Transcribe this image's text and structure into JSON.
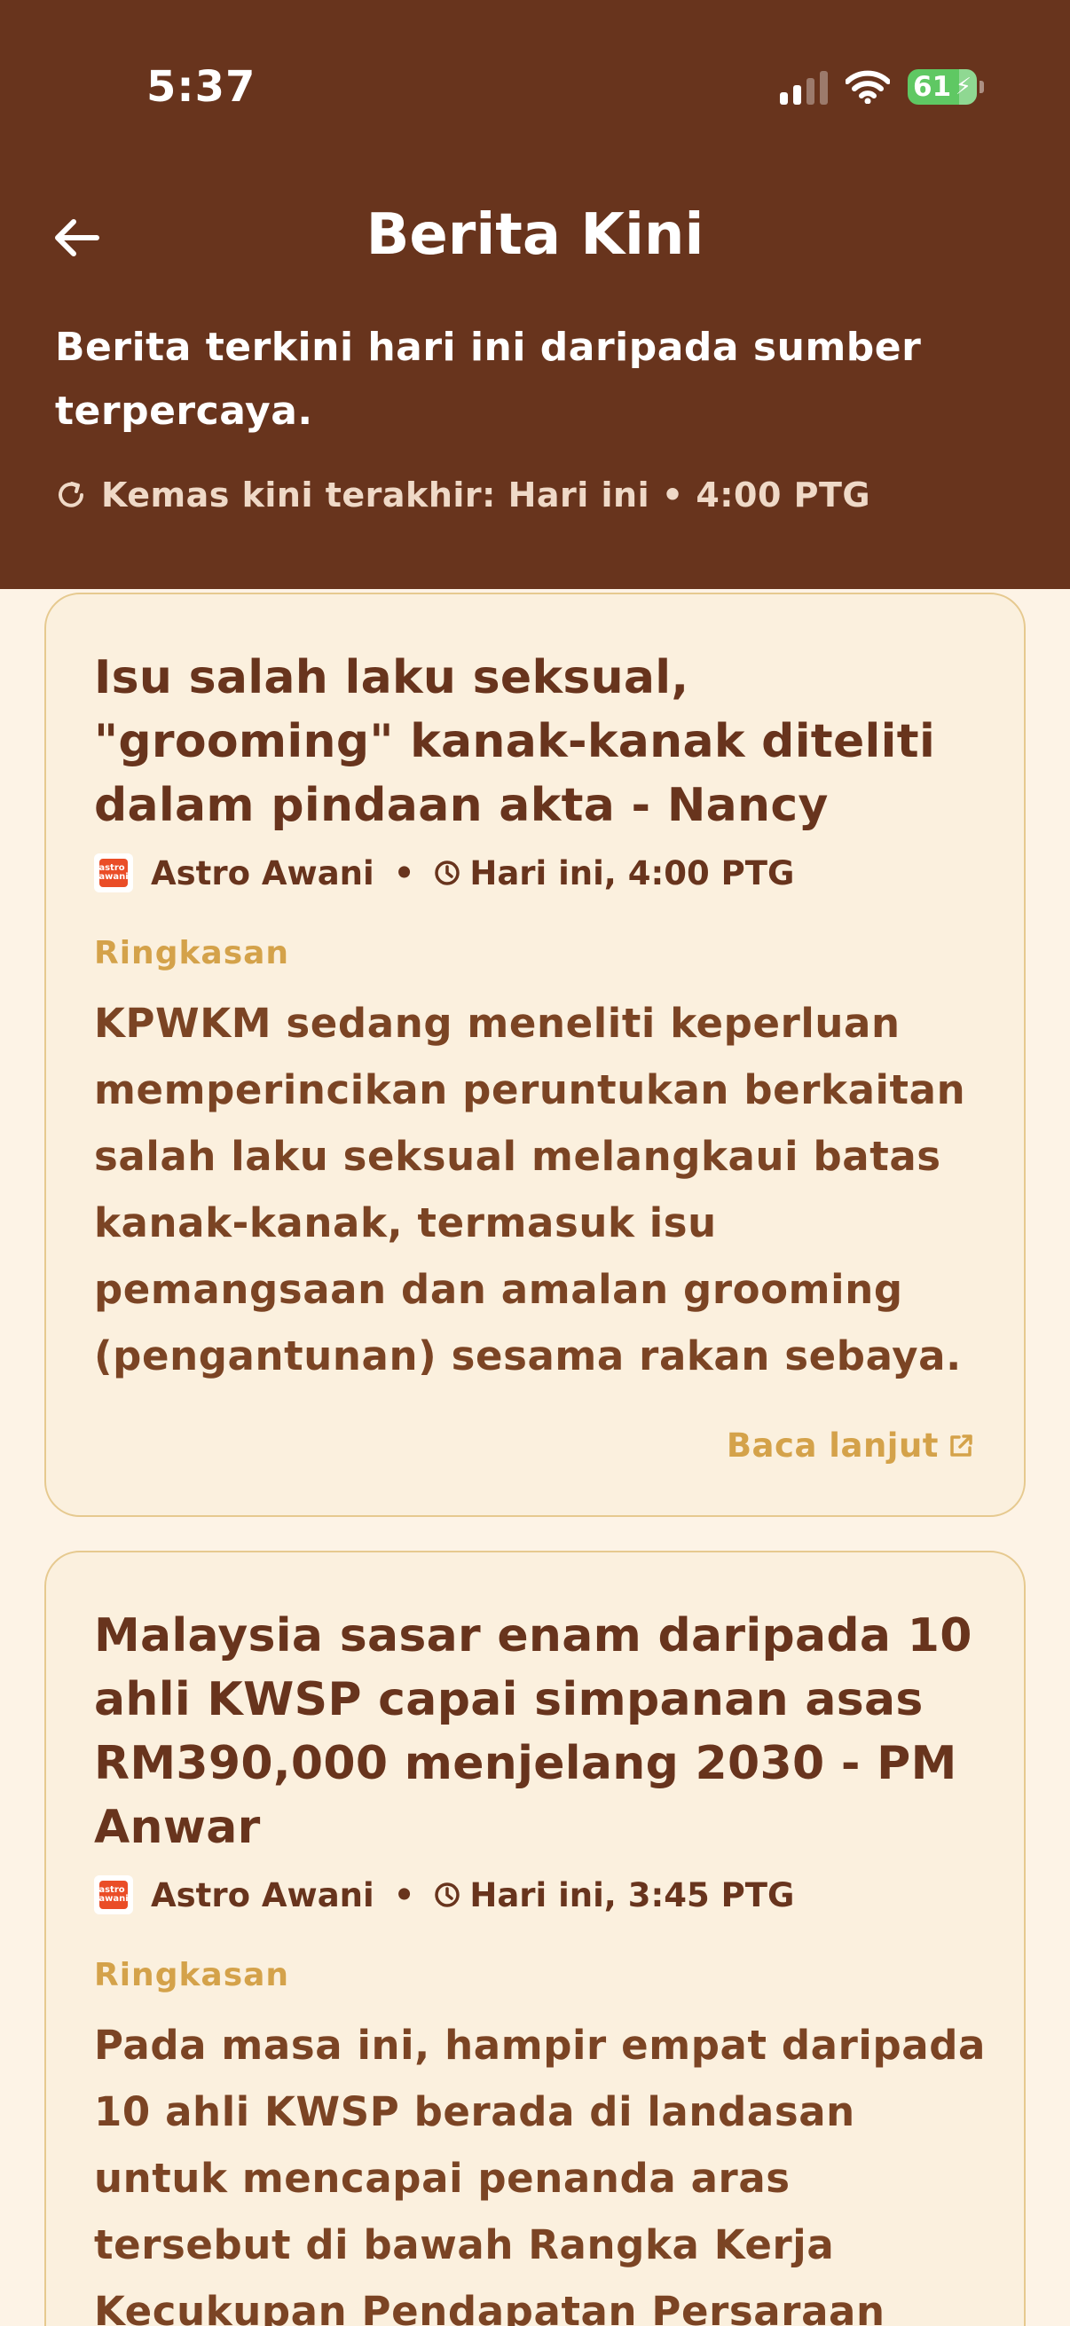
{
  "status_bar": {
    "time": "5:37",
    "battery_level": "61",
    "battery_color": "#5fc863"
  },
  "header": {
    "title": "Berita Kini",
    "subtitle": "Berita terkini hari ini daripada sumber terpercaya.",
    "last_updated": "Kemas kini terakhir: Hari ini • 4:00 PTG",
    "icons": {
      "back": "arrow-left-icon",
      "refresh": "refresh-icon"
    },
    "background_color": "#68341d"
  },
  "summary_label": "Ringkasan",
  "read_more_label": "Baca lanjut",
  "articles": [
    {
      "title": "Isu salah laku seksual, \"grooming\" kanak-kanak diteliti dalam pindaan akta - Nancy",
      "source": "Astro Awani",
      "source_logo_text": "astro awani",
      "time": "Hari ini, 4:00 PTG",
      "summary": "KPWKM sedang meneliti keperluan memperincikan peruntukan berkaitan salah laku seksual melangkaui batas kanak-kanak, termasuk isu pemangsaan dan amalan grooming (pengantunan) sesama rakan sebaya."
    },
    {
      "title": "Malaysia sasar enam daripada 10 ahli KWSP capai simpanan asas RM390,000 menjelang 2030 - PM Anwar",
      "source": "Astro Awani",
      "source_logo_text": "astro awani",
      "time": "Hari ini, 3:45 PTG",
      "summary": "Pada masa ini, hampir empat daripada 10 ahli KWSP berada di landasan untuk mencapai penanda aras tersebut di bawah Rangka Kerja Kecukupan Pendapatan Persaraan"
    }
  ],
  "colors": {
    "accent": "#d4a24a",
    "card_background": "#fbf0de",
    "card_border": "#e6c98f",
    "text_brown": "#68341d"
  }
}
